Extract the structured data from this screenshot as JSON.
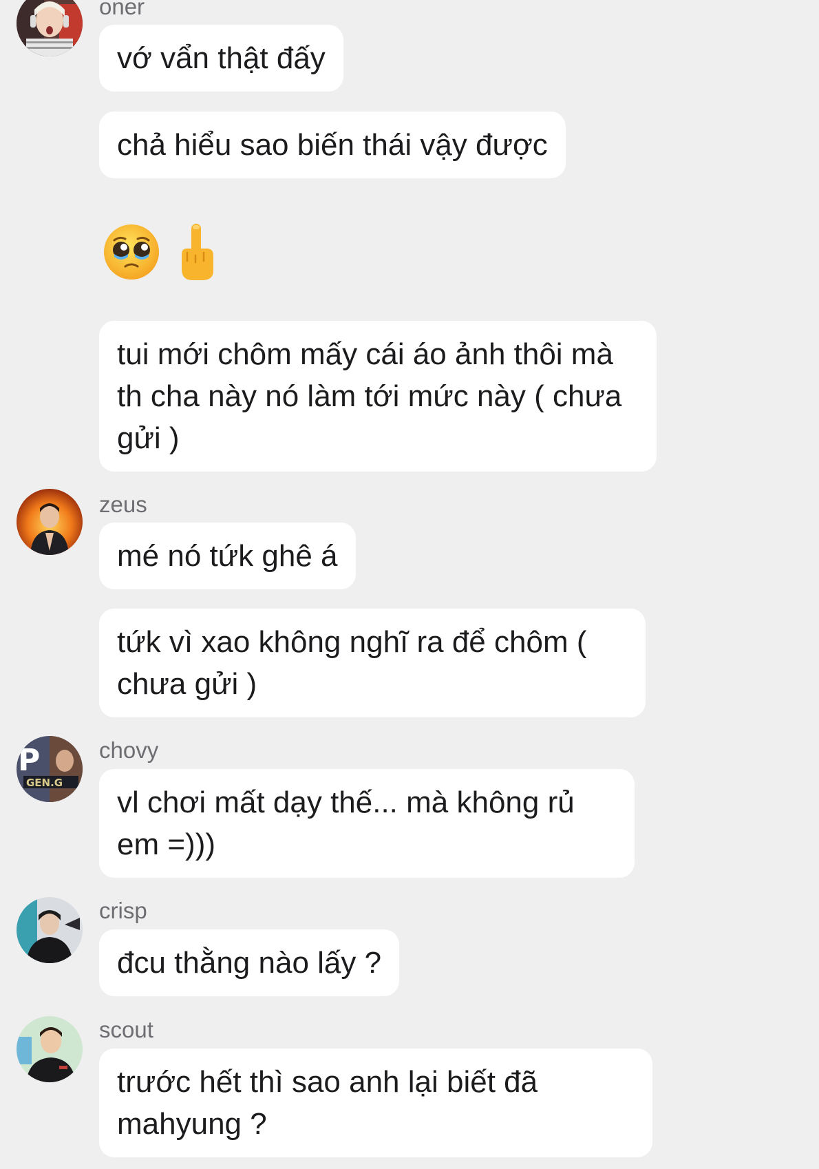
{
  "messages": [
    {
      "sender": "oner",
      "bubbles": [
        "vớ vẩn thật đấy",
        "chả hiểu sao biến thái vậy được"
      ]
    },
    {
      "emojis": [
        "pleading-face",
        "middle-finger"
      ]
    },
    {
      "bubbles": [
        "tui mới chôm mấy cái áo ảnh thôi mà th cha này nó làm tới mức này ( chưa gửi )"
      ]
    },
    {
      "sender": "zeus",
      "bubbles": [
        "mé nó tứk ghê á",
        "tứk vì xao không nghĩ ra để chôm ( chưa gửi )"
      ]
    },
    {
      "sender": "chovy",
      "bubbles": [
        "vl chơi mất dạy thế... mà không rủ em =)))"
      ],
      "avatar_text": "GEN.G"
    },
    {
      "sender": "crisp",
      "bubbles": [
        "đcu thằng nào lấy ?"
      ]
    },
    {
      "sender": "scout",
      "bubbles": [
        "trước hết thì sao anh lại biết đã mahyung ?"
      ]
    }
  ],
  "colors": {
    "background": "#efeff0",
    "bubble": "#ffffff",
    "text": "#1c1c1e",
    "sender": "#6d6d72"
  }
}
